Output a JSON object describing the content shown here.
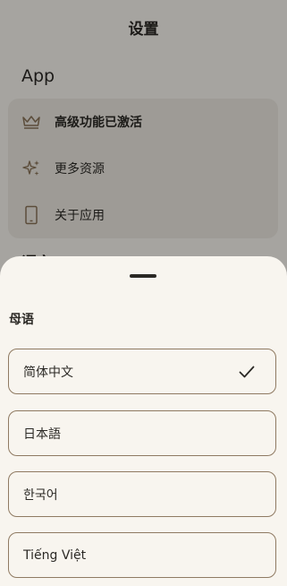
{
  "header": {
    "title": "设置"
  },
  "app_section": {
    "label": "App",
    "items": [
      {
        "label": "高级功能已激活",
        "icon": "crown-icon"
      },
      {
        "label": "更多资源",
        "icon": "sparkle-icon"
      },
      {
        "label": "关于应用",
        "icon": "phone-icon"
      }
    ]
  },
  "next_section": {
    "label": "语言"
  },
  "sheet": {
    "title": "母语",
    "options": [
      {
        "label": "简体中文",
        "selected": true
      },
      {
        "label": "日本語",
        "selected": false
      },
      {
        "label": "한국어",
        "selected": false
      },
      {
        "label": "Tiếng Việt",
        "selected": false
      }
    ]
  },
  "colors": {
    "accent_border": "#8f7a62",
    "icon": "#8a7458",
    "scrim": "rgba(0,0,0,0.33)"
  }
}
